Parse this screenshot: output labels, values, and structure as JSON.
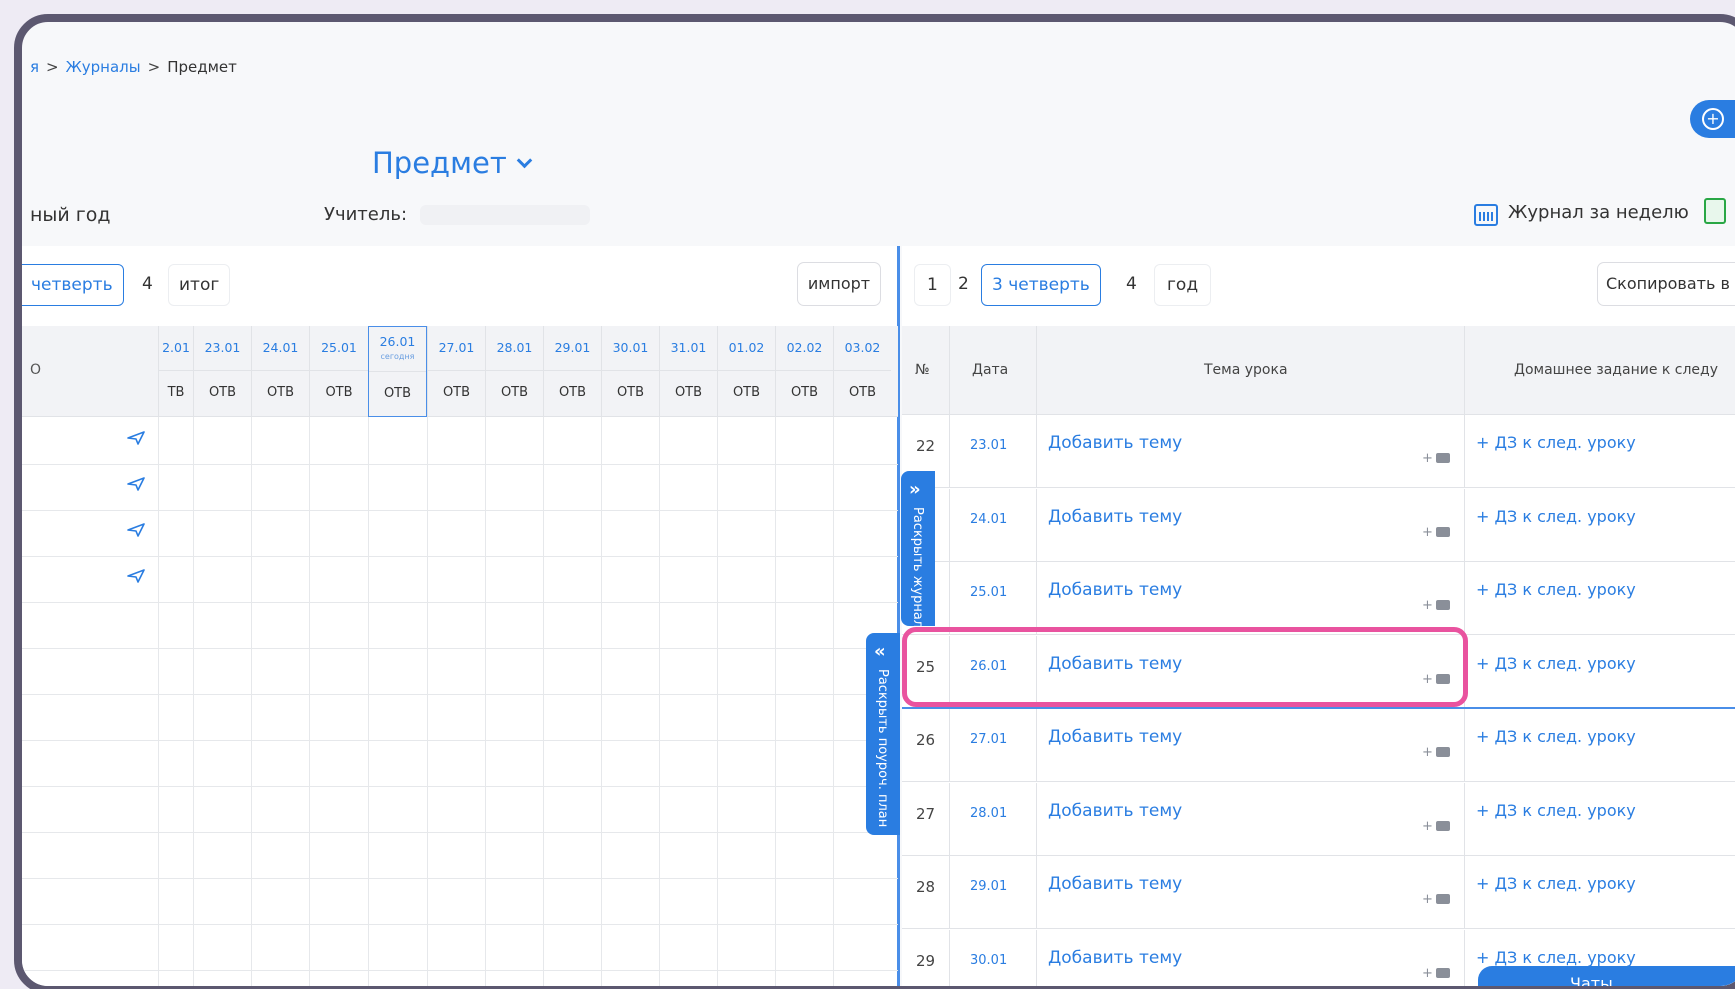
{
  "breadcrumb": {
    "part1": "я",
    "part2": "Журналы",
    "part3": "Предмет",
    "separator": ">"
  },
  "subject_title": "Предмет",
  "school_year": "ный год",
  "teacher_label": "Учитель:",
  "week_journal": "Журнал за неделю",
  "left_tabs": {
    "active": "четверть",
    "t4": "4",
    "total": "итог"
  },
  "import_button": "импорт",
  "right_tabs": {
    "t1": "1",
    "t2": "2",
    "active": "3 четверть",
    "t4": "4",
    "year": "год"
  },
  "copy_button": "Скопировать в",
  "left_table": {
    "fio_header": "О",
    "today_label": "сегодня",
    "dates": [
      {
        "d": "2.01",
        "o": "ТВ"
      },
      {
        "d": "23.01",
        "o": "ОТВ"
      },
      {
        "d": "24.01",
        "o": "ОТВ"
      },
      {
        "d": "25.01",
        "o": "ОТВ"
      },
      {
        "d": "26.01",
        "o": "ОТВ"
      },
      {
        "d": "27.01",
        "o": "ОТВ"
      },
      {
        "d": "28.01",
        "o": "ОТВ"
      },
      {
        "d": "29.01",
        "o": "ОТВ"
      },
      {
        "d": "30.01",
        "o": "ОТВ"
      },
      {
        "d": "31.01",
        "o": "ОТВ"
      },
      {
        "d": "01.02",
        "o": "ОТВ"
      },
      {
        "d": "02.02",
        "o": "ОТВ"
      },
      {
        "d": "03.02",
        "o": "ОТВ"
      }
    ]
  },
  "right_table": {
    "headers": {
      "num": "№",
      "date": "Дата",
      "topic": "Тема урока",
      "homework": "Домашнее задание к следу"
    },
    "add_topic": "Добавить тему",
    "add_hw": "+ ДЗ к след. уроку",
    "cam_plus": "+",
    "rows": [
      {
        "n": "22",
        "date": "23.01"
      },
      {
        "n": "",
        "date": "24.01"
      },
      {
        "n": "",
        "date": "25.01"
      },
      {
        "n": "25",
        "date": "26.01"
      },
      {
        "n": "26",
        "date": "27.01"
      },
      {
        "n": "27",
        "date": "28.01"
      },
      {
        "n": "28",
        "date": "29.01"
      },
      {
        "n": "29",
        "date": "30.01"
      }
    ]
  },
  "expand_journal": "Раскрыть журнал",
  "expand_plan": "Раскрыть поуроч. план",
  "chats_label": "Чаты",
  "colors": {
    "accent": "#2a7de1",
    "highlight": "#e9539f",
    "frame": "#5c5870"
  }
}
